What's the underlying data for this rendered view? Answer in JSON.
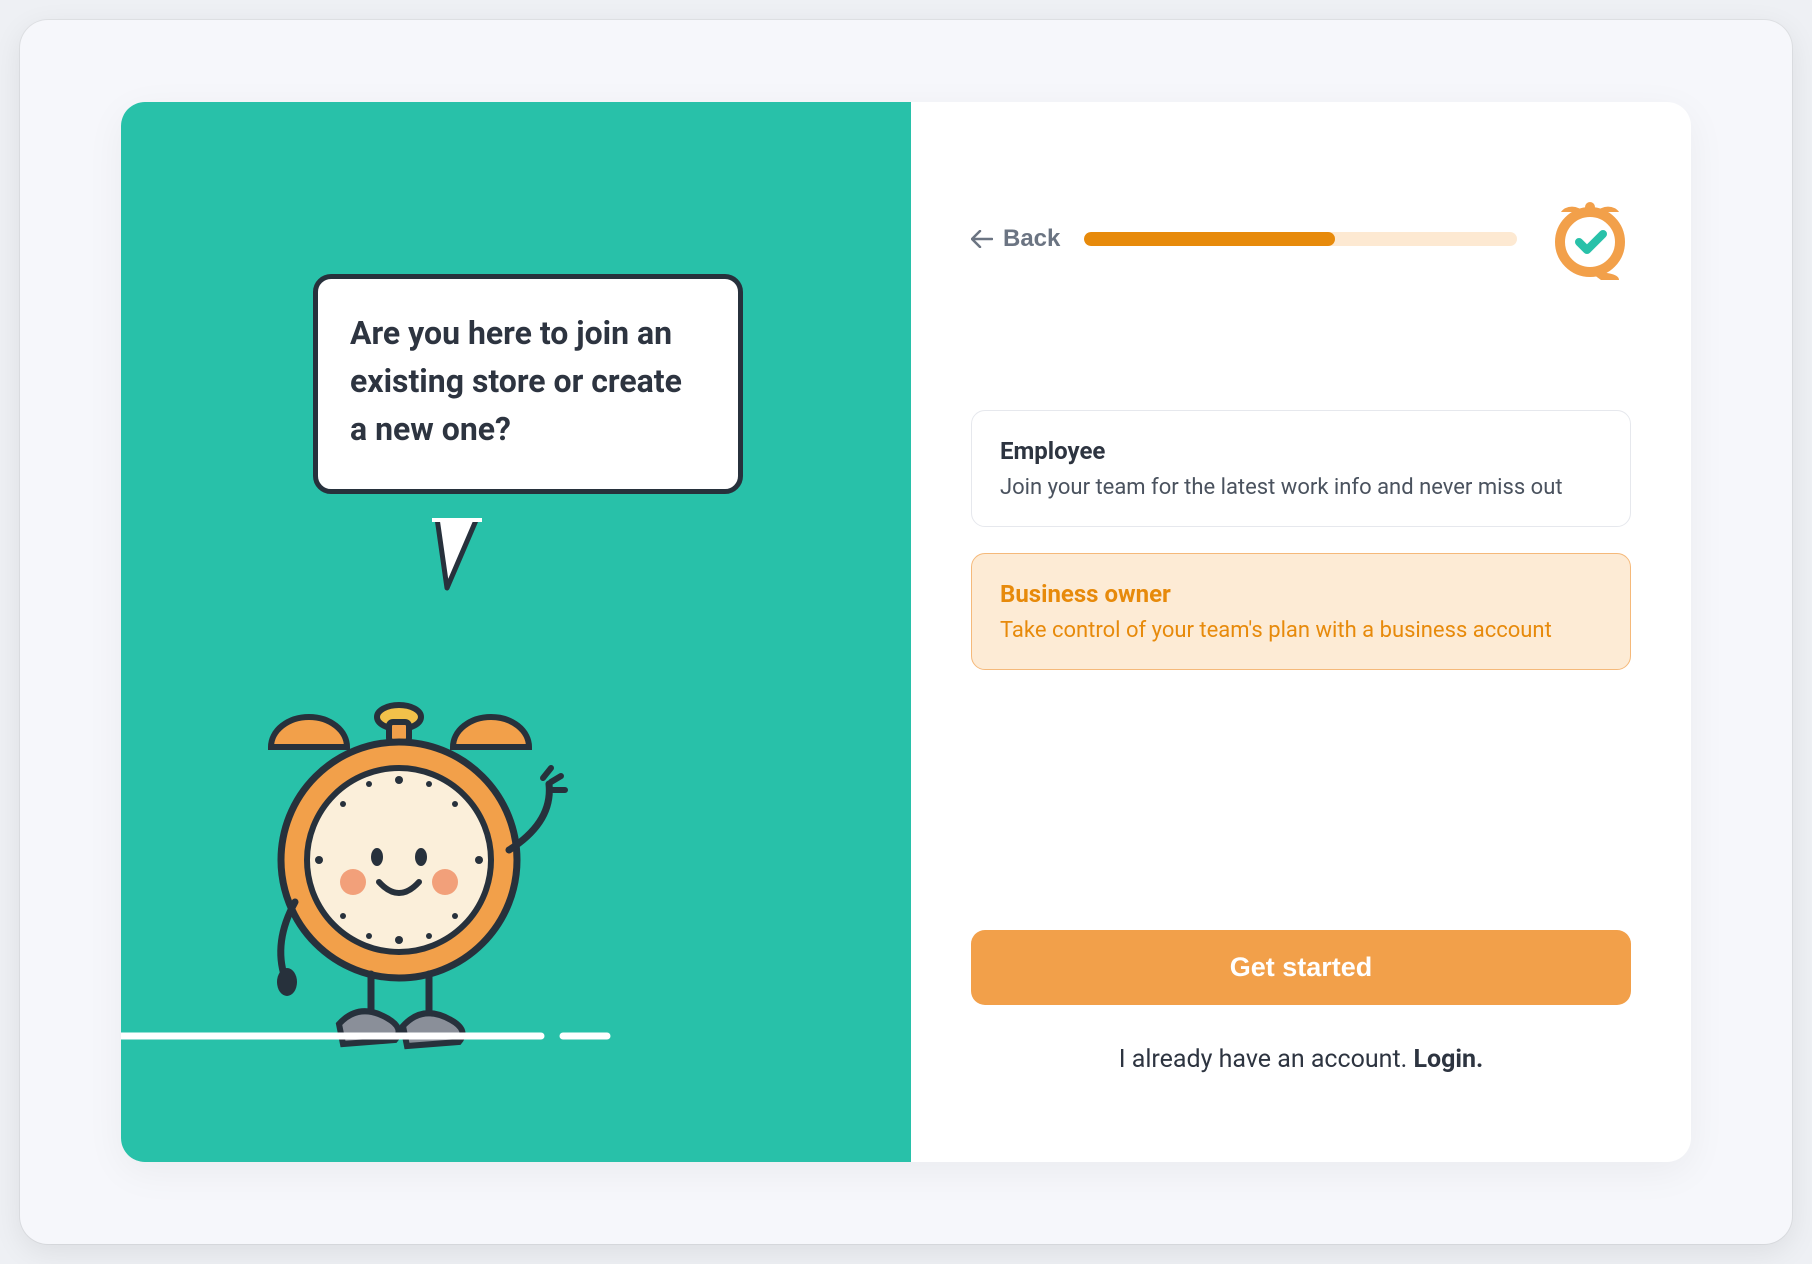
{
  "speech_bubble": "Are you here to join an existing store or create a new one?",
  "header": {
    "back_label": "Back",
    "progress_percent": 58
  },
  "options": [
    {
      "title": "Employee",
      "desc": "Join your team for the latest work info and never miss out",
      "selected": false
    },
    {
      "title": "Business owner",
      "desc": "Take control of your team's plan with a business account",
      "selected": true
    }
  ],
  "cta": {
    "primary_label": "Get started",
    "login_prefix": "I already have an account. ",
    "login_link": "Login."
  },
  "colors": {
    "teal": "#28c1a9",
    "orange": "#f2a04a",
    "orange_dark": "#e78a0b"
  }
}
